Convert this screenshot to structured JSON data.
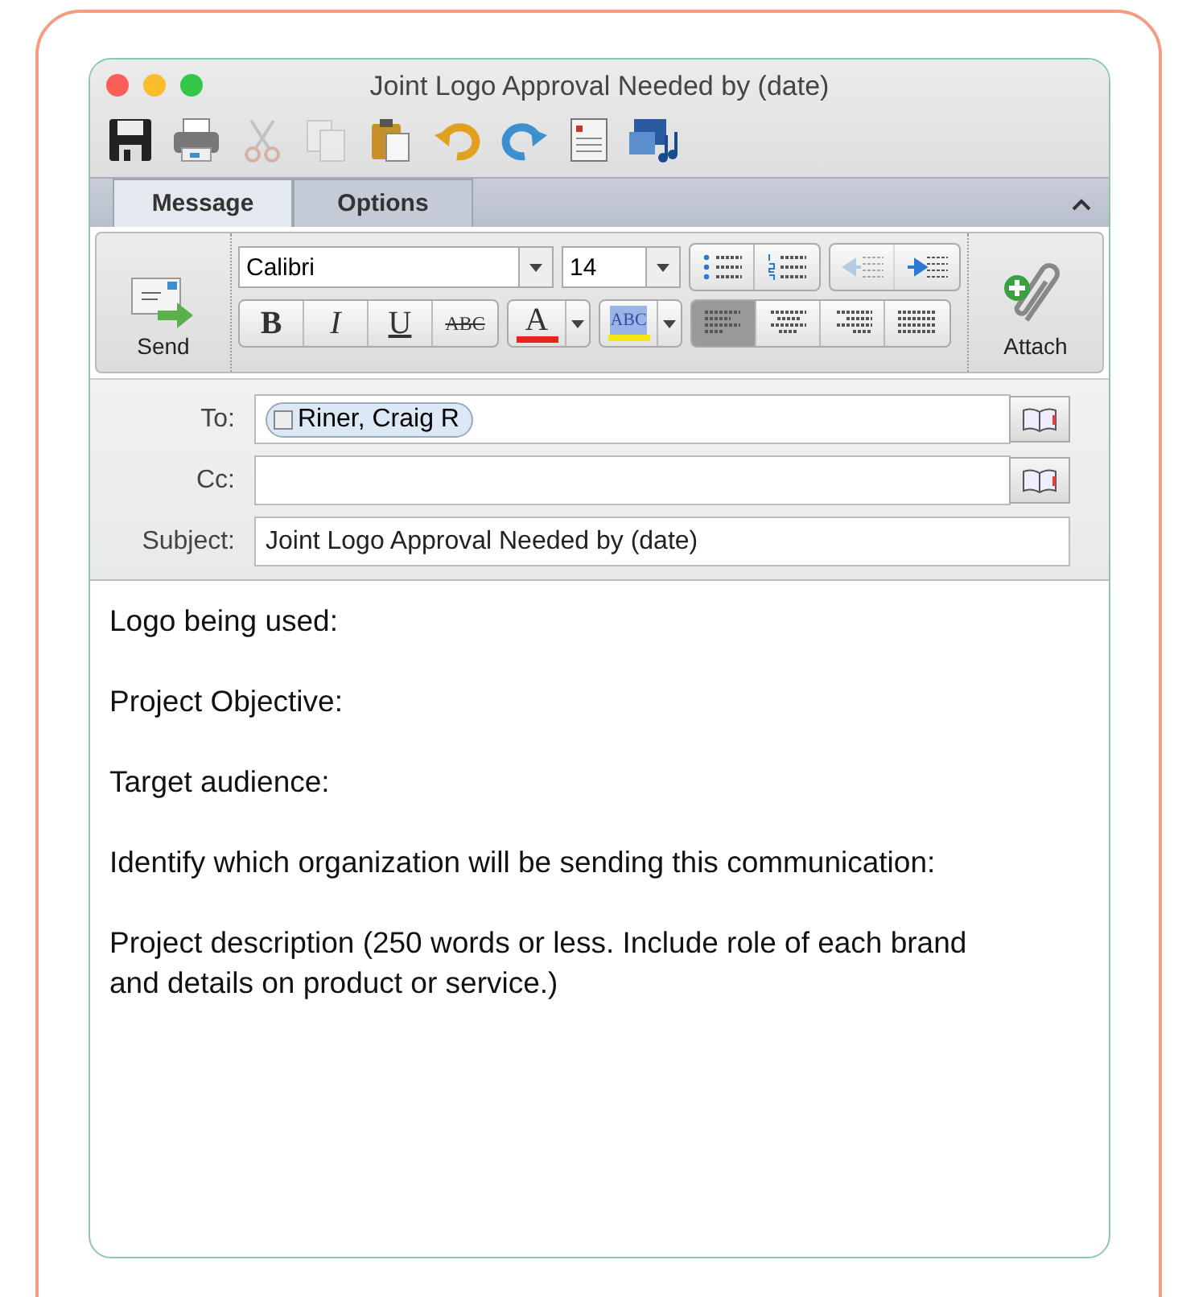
{
  "window": {
    "title": "Joint Logo Approval Needed by (date)"
  },
  "toolbar": [
    {
      "kind": "save",
      "disabled": false
    },
    {
      "kind": "print",
      "disabled": false
    },
    {
      "kind": "cut",
      "disabled": true
    },
    {
      "kind": "copy",
      "disabled": true
    },
    {
      "kind": "paste",
      "disabled": false
    },
    {
      "kind": "undo",
      "disabled": false
    },
    {
      "kind": "redo",
      "disabled": false
    },
    {
      "kind": "form",
      "disabled": false
    },
    {
      "kind": "media",
      "disabled": false
    }
  ],
  "tabs": [
    {
      "label": "Message",
      "selected": true
    },
    {
      "label": "Options",
      "selected": false
    }
  ],
  "ribbon": {
    "send": "Send",
    "attach": "Attach",
    "font": "Calibri",
    "size": "14",
    "lists": [
      {
        "kind": "bullets"
      },
      {
        "kind": "numbers"
      }
    ],
    "indent": [
      {
        "kind": "decrease",
        "disabled": true
      },
      {
        "kind": "increase",
        "disabled": false
      }
    ],
    "format": [
      {
        "kind": "bold",
        "label": "B"
      },
      {
        "kind": "italic",
        "label": "I"
      },
      {
        "kind": "underline",
        "label": "U"
      },
      {
        "kind": "strike",
        "label": "ABC"
      }
    ],
    "font_color": {
      "label": "A",
      "color": "#e8231c"
    },
    "highlight": {
      "label": "ABC",
      "color": "#f6e814"
    },
    "align": [
      {
        "kind": "left",
        "selected": true
      },
      {
        "kind": "center",
        "selected": false
      },
      {
        "kind": "right",
        "selected": false
      },
      {
        "kind": "justify",
        "selected": false
      }
    ]
  },
  "fields": [
    {
      "label": "To:",
      "recipients": [
        "Riner, Craig R"
      ],
      "book": true
    },
    {
      "label": "Cc:",
      "book": true
    },
    {
      "label": "Subject:",
      "value": "Joint Logo Approval Needed by (date)",
      "book": false
    }
  ],
  "body": [
    "Logo being used:",
    "Project Objective:",
    "Target audience:",
    "Identify which organization will be sending this communication:",
    "Project description (250 words or less. Include role of each brand and details on product or service.)"
  ]
}
